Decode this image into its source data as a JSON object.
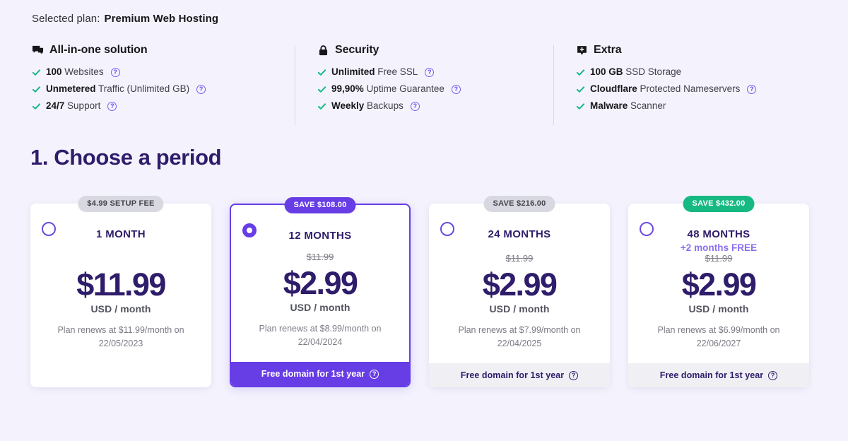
{
  "header": {
    "selected_plan_label": "Selected plan:",
    "selected_plan_value": "Premium Web Hosting"
  },
  "feature_columns": [
    {
      "icon": "chat-bubble-icon",
      "title": "All-in-one solution",
      "items": [
        {
          "strong": "100",
          "rest": "Websites",
          "help": true
        },
        {
          "strong": "Unmetered",
          "rest": "Traffic (Unlimited GB)",
          "help": true
        },
        {
          "strong": "24/7",
          "rest": "Support",
          "help": true
        }
      ]
    },
    {
      "icon": "lock-icon",
      "title": "Security",
      "items": [
        {
          "strong": "Unlimited",
          "rest": "Free SSL",
          "help": true
        },
        {
          "strong": "99,90%",
          "rest": "Uptime Guarantee",
          "help": true
        },
        {
          "strong": "Weekly",
          "rest": "Backups",
          "help": true
        }
      ]
    },
    {
      "icon": "plus-badge-icon",
      "title": "Extra",
      "items": [
        {
          "strong": "100 GB",
          "rest": "SSD Storage",
          "help": false
        },
        {
          "strong": "Cloudflare",
          "rest": "Protected Nameservers",
          "help": true
        },
        {
          "strong": "Malware",
          "rest": "Scanner",
          "help": false
        }
      ]
    }
  ],
  "section": {
    "title": "1. Choose a period"
  },
  "colors": {
    "brand_purple": "#673de6",
    "deep_purple": "#2f1c6a",
    "green": "#16b981",
    "gray_badge": "#d8d8e0",
    "page_background": "#f4f3fd"
  },
  "plans": [
    {
      "badge": {
        "text": "$4.99 SETUP FEE",
        "style": "gray"
      },
      "term": "1 MONTH",
      "bonus": "",
      "old_price": "",
      "price": "$11.99",
      "per": "USD / month",
      "renew_line1": "Plan renews at $11.99/month on",
      "renew_line2": "22/05/2023",
      "selected": false,
      "footer": {
        "text": "",
        "style": "none",
        "help": false
      }
    },
    {
      "badge": {
        "text": "SAVE $108.00",
        "style": "purple"
      },
      "term": "12 MONTHS",
      "bonus": "",
      "old_price": "$11.99",
      "price": "$2.99",
      "per": "USD / month",
      "renew_line1": "Plan renews at $8.99/month on",
      "renew_line2": "22/04/2024",
      "selected": true,
      "footer": {
        "text": "Free domain for 1st year",
        "style": "filled",
        "help": true
      }
    },
    {
      "badge": {
        "text": "SAVE $216.00",
        "style": "gray"
      },
      "term": "24 MONTHS",
      "bonus": "",
      "old_price": "$11.99",
      "price": "$2.99",
      "per": "USD / month",
      "renew_line1": "Plan renews at $7.99/month on",
      "renew_line2": "22/04/2025",
      "selected": false,
      "footer": {
        "text": "Free domain for 1st year",
        "style": "plain",
        "help": true
      }
    },
    {
      "badge": {
        "text": "SAVE $432.00",
        "style": "green"
      },
      "term": "48 MONTHS",
      "bonus": "+2 months FREE",
      "old_price": "$11.99",
      "price": "$2.99",
      "per": "USD / month",
      "renew_line1": "Plan renews at $6.99/month on",
      "renew_line2": "22/06/2027",
      "selected": false,
      "footer": {
        "text": "Free domain for 1st year",
        "style": "plain",
        "help": true
      }
    }
  ],
  "icons": {
    "help": "?",
    "check": "check-icon"
  }
}
